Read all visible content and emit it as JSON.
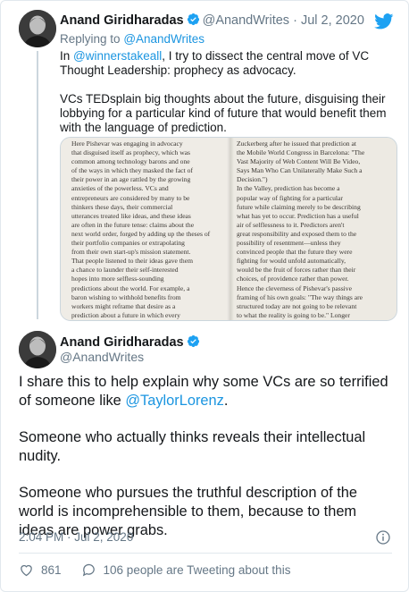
{
  "parent_tweet": {
    "author_name": "Anand Giridharadas",
    "handle": "@AnandWrites",
    "separator": "·",
    "date": "Jul 2, 2020",
    "replying_prefix": "Replying to",
    "replying_to": "@AnandWrites",
    "text_p1_prefix": "In",
    "text_p1_mention": "@winnerstakeall",
    "text_p1_rest": ", I try to dissect the central move of VC Thought Leadership: prophecy as advocacy.",
    "text_p2": "VCs TEDsplain big thoughts about the future, disguising their lobbying for a particular kind of future that would benefit them with the language of prediction.",
    "image": {
      "left_lines": [
        "Here Pishevar was engaging in advocacy",
        "that disguised itself as prophecy, which was",
        "common among technology barons and one",
        "of the ways in which they masked the fact of",
        "their power in an age rattled by the growing",
        "anxieties of the powerless. VCs and",
        "entrepreneurs are considered by many to be",
        "thinkers these days, their commercial",
        "utterances treated like ideas, and these ideas",
        "are often in the future tense: claims about the",
        "next world order, forged by adding up the theses of",
        "their portfolio companies or extrapolating",
        "from their own start-up's mission statement.",
        "That people listened to their ideas gave them",
        "a chance to launder their self-interested",
        "hopes into more selfless-sounding",
        "predictions about the world. For example, a",
        "baron wishing to withhold benefits from",
        "workers might reframe that desire as a",
        "prediction about a future in which every"
      ],
      "right_lines": [
        "Zuckerberg after he issued that prediction at",
        "the Mobile World Congress in Barcelona: \"The",
        "Vast Majority of Web Content Will Be Video,",
        "Says Man Who Can Unilaterally Make Such a",
        "Decision.\")",
        "In the Valley, prediction has become a",
        "popular way of fighting for a particular",
        "future while claiming merely to be describing",
        "what has yet to occur. Prediction has a useful",
        "air of selflessness to it. Predictors aren't",
        "great responsibility and exposed them to the",
        "possibility of resentment—unless they",
        "convinced people that the future they were",
        "fighting for would unfold automatically,",
        "would be the fruit of forces rather than their",
        "choices, of providence rather than power.",
        "Hence the cleverness of Pishevar's passive",
        "framing of his own goals: \"The way things are",
        "structured today are not going to be relevant",
        "to what the reality is going to be.\" Longer"
      ]
    }
  },
  "main_tweet": {
    "author_name": "Anand Giridharadas",
    "handle": "@AnandWrites",
    "p1_prefix": "I share this to help explain why some VCs are so terrified of someone like",
    "p1_mention": "@TaylorLorenz",
    "p1_suffix": ".",
    "p2": "Someone who actually thinks reveals their intellectual nudity.",
    "p3": "Someone who pursues the truthful description of the world is incomprehensible to them, because to them ideas are power grabs.",
    "timestamp": "2:04 PM · Jul 2, 2020",
    "like_count": "861",
    "discussion_label": "106 people are Tweeting about this"
  },
  "colors": {
    "link": "#1b95e0",
    "verified": "#1da1f2",
    "muted": "#657786",
    "twitter_blue": "#1da1f2"
  },
  "icons": {
    "verified": "verified-badge-icon",
    "brand": "twitter-bird-icon",
    "info": "info-icon",
    "like": "heart-icon",
    "reply": "speech-bubble-icon"
  }
}
